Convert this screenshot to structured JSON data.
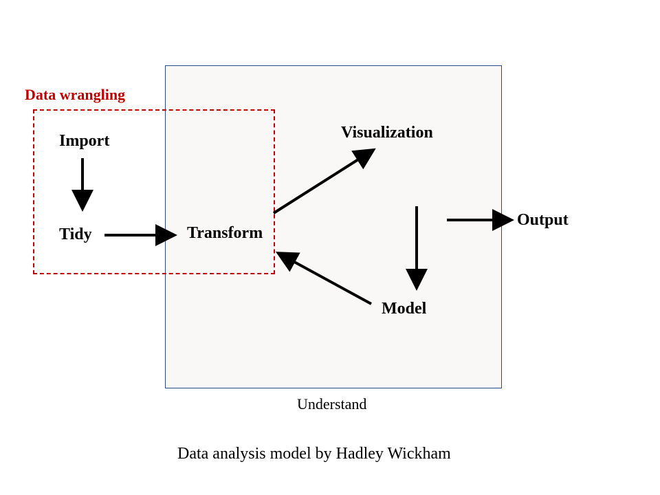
{
  "labels": {
    "wrangling": "Data wrangling",
    "import": "Import",
    "tidy": "Tidy",
    "transform": "Transform",
    "visualization": "Visualization",
    "model": "Model",
    "output": "Output",
    "understand": "Understand"
  },
  "caption": "Data analysis model by Hadley Wickham"
}
